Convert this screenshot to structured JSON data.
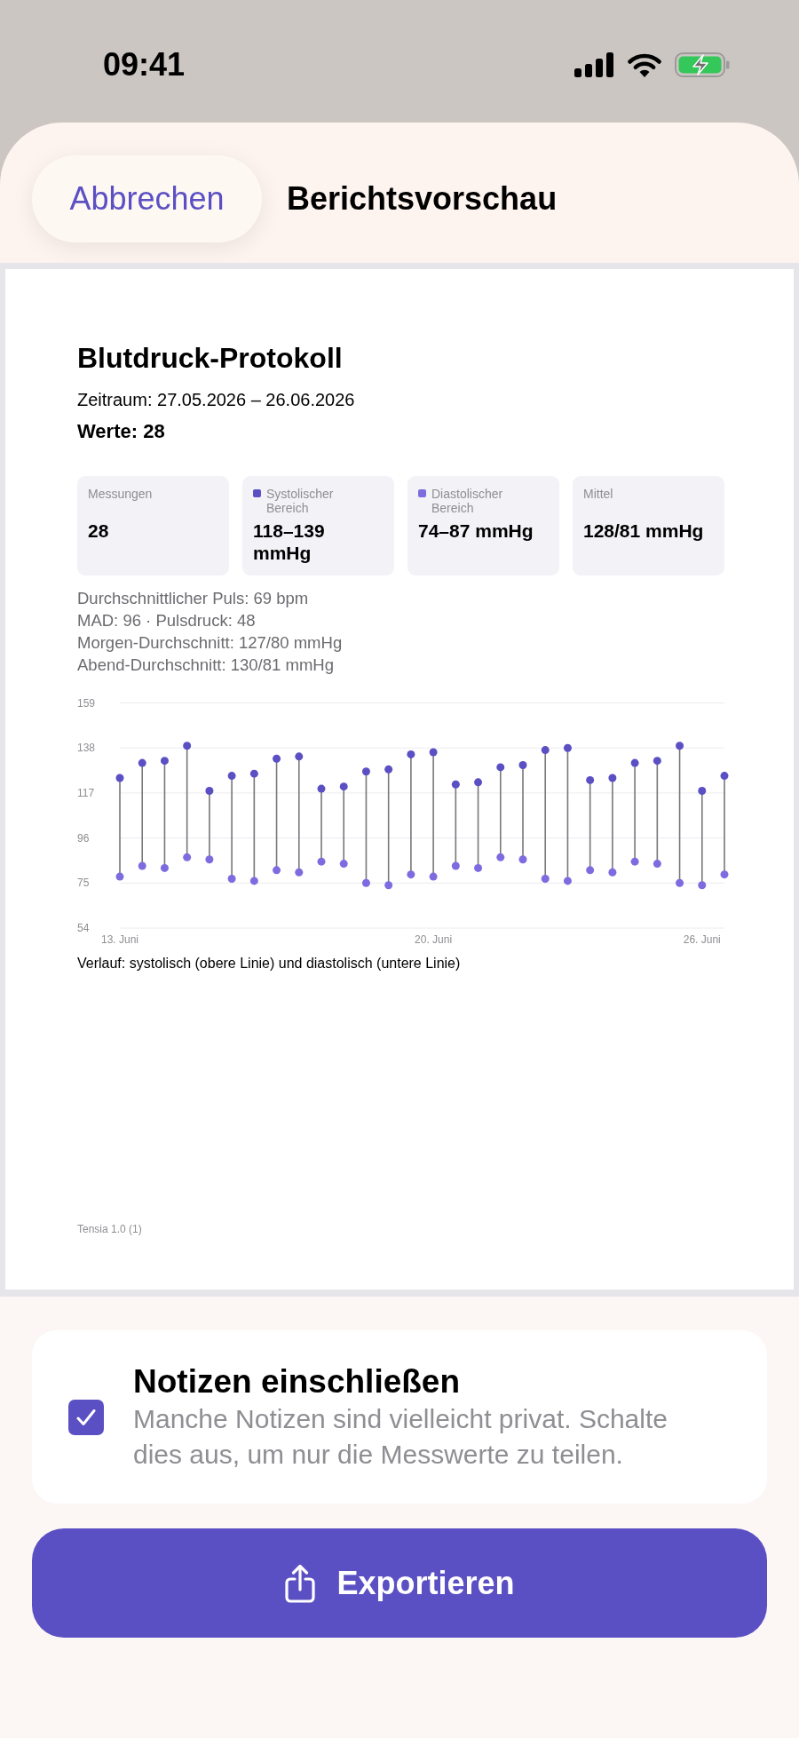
{
  "status_bar": {
    "time": "09:41"
  },
  "header": {
    "cancel_button": "Abbrechen",
    "title": "Berichtsvorschau"
  },
  "report": {
    "title": "Blutdruck-Protokoll",
    "period": "Zeitraum: 27.05.2026 – 26.06.2026",
    "count": "Werte: 28",
    "stat_cards": [
      {
        "label": "Messungen",
        "value": "28"
      },
      {
        "label": "Systolischer Bereich",
        "value": "118–139 mmHg",
        "color": "#5b4fc4"
      },
      {
        "label": "Diastolischer Bereich",
        "value": "74–87 mmHg",
        "color": "#7d6ce0"
      },
      {
        "label": "Mittel",
        "value": "128/81 mmHg"
      }
    ],
    "summary_lines": [
      "Durchschnittlicher Puls: 69 bpm",
      "MAD: 96 · Pulsdruck: 48",
      "Morgen-Durchschnitt: 127/80 mmHg",
      "Abend-Durchschnitt: 130/81 mmHg"
    ],
    "chart_data": {
      "type": "scatter",
      "categories": [
        "13. Juni",
        null,
        null,
        null,
        null,
        null,
        null,
        null,
        null,
        null,
        null,
        null,
        null,
        null,
        "20. Juni",
        null,
        null,
        null,
        null,
        null,
        null,
        null,
        null,
        null,
        null,
        null,
        "26. Juni",
        null
      ],
      "series": [
        {
          "color": "#5b4fc4",
          "values": [
            124,
            131,
            132,
            139,
            118,
            125,
            126,
            133,
            134,
            119,
            120,
            127,
            128,
            135,
            136,
            121,
            122,
            129,
            130,
            137,
            138,
            123,
            124,
            131,
            132,
            139,
            118,
            125
          ]
        },
        {
          "color": "#7d6ce0",
          "values": [
            78,
            83,
            82,
            87,
            86,
            77,
            76,
            81,
            80,
            85,
            84,
            75,
            74,
            79,
            78,
            83,
            82,
            87,
            86,
            77,
            76,
            81,
            80,
            85,
            84,
            75,
            74,
            79
          ]
        }
      ],
      "ylim": [
        54,
        159
      ],
      "yticks": [
        54,
        75,
        96,
        117,
        138,
        159
      ],
      "grid": true
    },
    "chart_caption": "Verlauf: systolisch (obere Linie) und diastolisch (untere Linie)",
    "footer": "Tensia 1.0 (1)"
  },
  "notes_option": {
    "title": "Notizen einschließen",
    "description": "Manche Notizen sind vielleicht privat. Schalte dies aus, um nur die Messwerte zu teilen.",
    "checked": true
  },
  "export_button": "Exportieren"
}
